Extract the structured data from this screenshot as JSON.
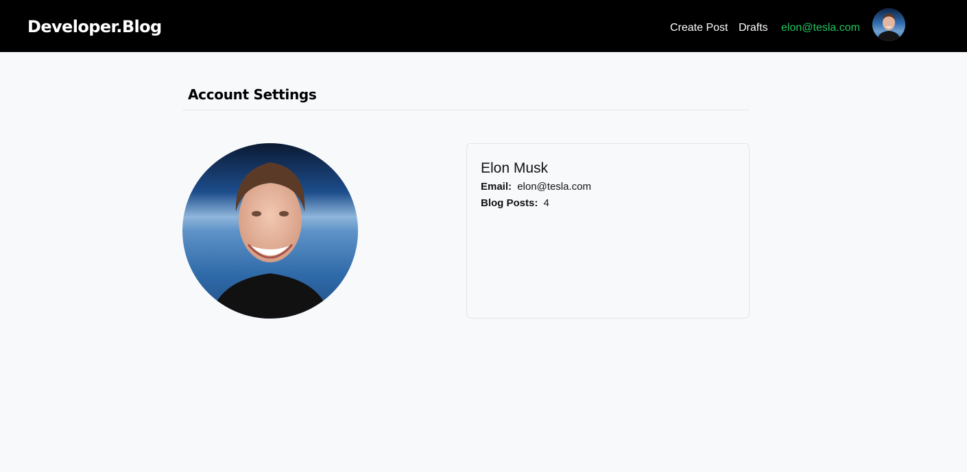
{
  "nav": {
    "brand": "Developer.Blog",
    "create_post": "Create Post",
    "drafts": "Drafts",
    "user_email": "elon@tesla.com",
    "email_color": "#22c55e",
    "avatar_icon": "user-avatar-photo"
  },
  "page": {
    "title": "Account Settings"
  },
  "profile": {
    "photo_icon": "profile-photo",
    "name": "Elon Musk",
    "email_label": "Email:",
    "email_value": "elon@tesla.com",
    "posts_label": "Blog Posts:",
    "posts_value": "4"
  }
}
